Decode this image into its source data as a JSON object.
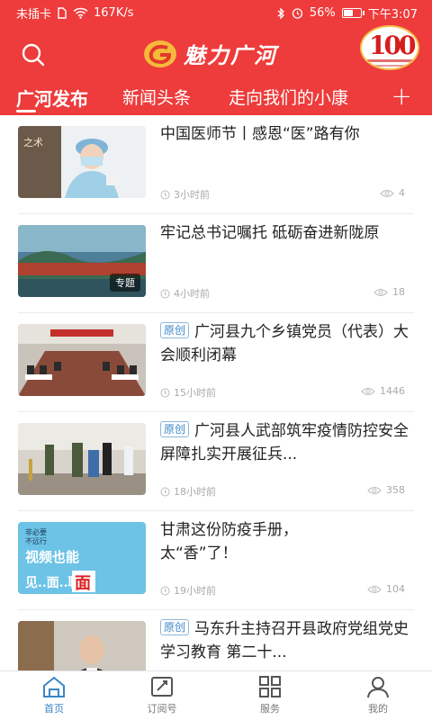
{
  "status": {
    "carrier": "未插卡",
    "speed": "167K/s",
    "battery": "56%",
    "battery_level": 0.56,
    "time": "下午3:07"
  },
  "header": {
    "app_name": "魅力广河",
    "badge_text": "100"
  },
  "tabs": [
    {
      "label": "广河发布",
      "active": true
    },
    {
      "label": "新闻头条"
    },
    {
      "label": "走向我们的小康"
    }
  ],
  "tabs_add": "+",
  "feed": [
    {
      "title": "中国医师节丨感恩“医”路有你",
      "tag": "",
      "time": "3小时前",
      "views": "4",
      "thumb_label": ""
    },
    {
      "title": "牢记总书记嘱托  砥砺奋进新陇原",
      "tag": "",
      "time": "4小时前",
      "views": "18",
      "thumb_label": "专题"
    },
    {
      "title": "广河县九个乡镇党员（代表）大会顺利闭幕",
      "tag": "原创",
      "time": "15小时前",
      "views": "1446",
      "thumb_label": ""
    },
    {
      "title": "广河县人武部筑牢疫情防控安全屏障扎实开展征兵...",
      "tag": "原创",
      "time": "18小时前",
      "views": "358",
      "thumb_label": ""
    },
    {
      "title": "甘肃这份防疫手册，\n太“香”了！",
      "tag": "",
      "time": "19小时前",
      "views": "104",
      "thumb_label": ""
    },
    {
      "title": "马东升主持召开县政府党组党史学习教育 第二十...",
      "tag": "原创",
      "time": "",
      "views": "",
      "thumb_label": ""
    }
  ],
  "thumb_texts": {
    "t1": "之术",
    "t5a": "非必要",
    "t5b": "不远行",
    "t5c": "视频也能",
    "t5d": "见..面..聊"
  },
  "bottomnav": [
    {
      "label": "首页",
      "icon": "home-icon",
      "active": true
    },
    {
      "label": "订阅号",
      "icon": "subscribe-icon"
    },
    {
      "label": "服务",
      "icon": "grid-icon"
    },
    {
      "label": "我的",
      "icon": "user-icon"
    }
  ],
  "colors": {
    "primary": "#ee3b3b",
    "accent": "#3b86c6"
  }
}
